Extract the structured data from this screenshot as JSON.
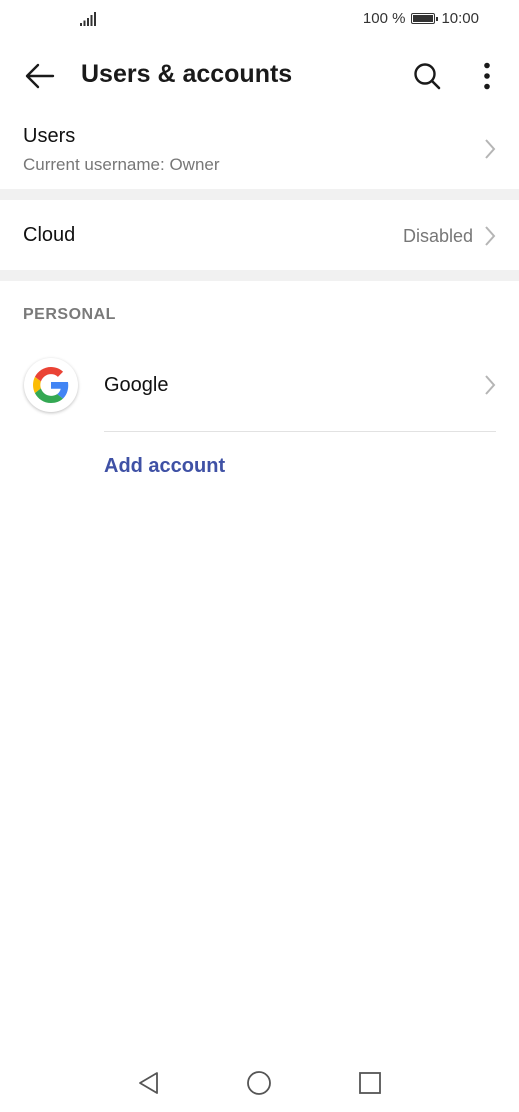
{
  "status_bar": {
    "battery": "100 %",
    "time": "10:00",
    "icons": [
      "signal-icon",
      "battery-icon"
    ]
  },
  "app_bar": {
    "title": "Users & accounts",
    "icons": [
      "back-arrow-icon",
      "search-icon",
      "more-vert-icon"
    ]
  },
  "users_row": {
    "title": "Users",
    "subtitle": "Current username: Owner"
  },
  "cloud_row": {
    "title": "Cloud",
    "value": "Disabled"
  },
  "personal_section": {
    "header": "PERSONAL",
    "accounts": [
      {
        "name": "Google",
        "icon": "google-logo-icon"
      }
    ],
    "add_account_label": "Add account"
  },
  "nav_bar": {
    "icons": [
      "nav-back-icon",
      "nav-home-icon",
      "nav-recents-icon"
    ]
  },
  "colors": {
    "accent": "#3f51a5",
    "secondary_text": "#777777",
    "divider_band": "#f1f1f1"
  }
}
